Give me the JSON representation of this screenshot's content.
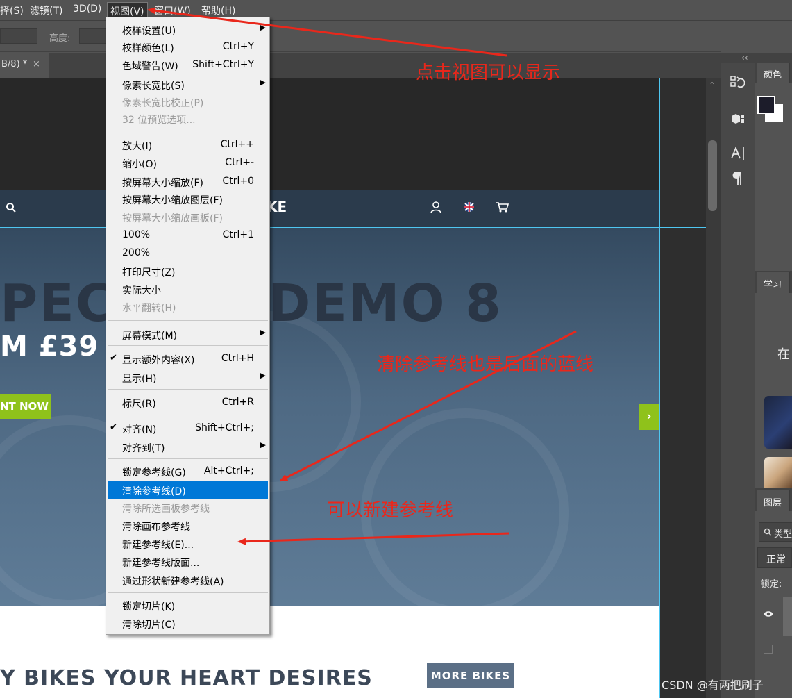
{
  "menubar": {
    "items": [
      "择(S)",
      "滤镜(T)",
      "3D(D)",
      "视图(V)",
      "窗口(W)",
      "帮助(H)"
    ],
    "active_index": 3
  },
  "options_bar": {
    "height_label": "高度:"
  },
  "document_tab": {
    "label": "B/8) *",
    "close": "×"
  },
  "canvas": {
    "header_logo_fragment": "KE",
    "hero_title_left": "PECIA",
    "hero_title_right": "DEMO 8",
    "hero_from": "M £39",
    "hero_button": "NT NOW",
    "hero_next": "›",
    "bottom_heading": "Y BIKES YOUR HEART DESIRES",
    "more_bikes_button": "MORE BIKES"
  },
  "scrollbar": {
    "up_arrow": "⌃"
  },
  "dock": {
    "collapse": "‹‹",
    "tools": [
      "history-icon",
      "3d-icon",
      "character-icon",
      "paragraph-icon"
    ],
    "panels": {
      "color": {
        "tab": "颜色"
      },
      "learn": {
        "tab": "学习",
        "text": "在"
      },
      "layers": {
        "tab": "图层",
        "search": "类型",
        "blend_mode": "正常",
        "lock_label": "锁定:"
      }
    }
  },
  "view_menu": {
    "items": [
      {
        "label": "校样设置(U)",
        "shortcut": "",
        "submenu": true
      },
      {
        "label": "校样颜色(L)",
        "shortcut": "Ctrl+Y"
      },
      {
        "label": "色域警告(W)",
        "shortcut": "Shift+Ctrl+Y"
      },
      {
        "label": "像素长宽比(S)",
        "shortcut": "",
        "submenu": true
      },
      {
        "label": "像素长宽比校正(P)",
        "shortcut": "",
        "disabled": true
      },
      {
        "label": "32 位预览选项...",
        "shortcut": "",
        "disabled": true
      },
      {
        "label": "放大(I)",
        "shortcut": "Ctrl++"
      },
      {
        "label": "缩小(O)",
        "shortcut": "Ctrl+-"
      },
      {
        "label": "按屏幕大小缩放(F)",
        "shortcut": "Ctrl+0"
      },
      {
        "label": "按屏幕大小缩放图层(F)",
        "shortcut": ""
      },
      {
        "label": "按屏幕大小缩放画板(F)",
        "shortcut": "",
        "disabled": true
      },
      {
        "label": "100%",
        "shortcut": "Ctrl+1"
      },
      {
        "label": "200%",
        "shortcut": ""
      },
      {
        "label": "打印尺寸(Z)",
        "shortcut": ""
      },
      {
        "label": "实际大小",
        "shortcut": ""
      },
      {
        "label": "水平翻转(H)",
        "shortcut": "",
        "disabled": true
      },
      {
        "label": "屏幕模式(M)",
        "shortcut": "",
        "submenu": true
      },
      {
        "label": "显示额外内容(X)",
        "shortcut": "Ctrl+H",
        "checked": true
      },
      {
        "label": "显示(H)",
        "shortcut": "",
        "submenu": true
      },
      {
        "label": "标尺(R)",
        "shortcut": "Ctrl+R"
      },
      {
        "label": "对齐(N)",
        "shortcut": "Shift+Ctrl+;",
        "checked": true
      },
      {
        "label": "对齐到(T)",
        "shortcut": "",
        "submenu": true
      },
      {
        "label": "锁定参考线(G)",
        "shortcut": "Alt+Ctrl+;"
      },
      {
        "label": "清除参考线(D)",
        "shortcut": "",
        "highlighted": true
      },
      {
        "label": "清除所选画板参考线",
        "shortcut": "",
        "disabled": true
      },
      {
        "label": "清除画布参考线",
        "shortcut": ""
      },
      {
        "label": "新建参考线(E)...",
        "shortcut": ""
      },
      {
        "label": "新建参考线版面...",
        "shortcut": ""
      },
      {
        "label": "通过形状新建参考线(A)",
        "shortcut": ""
      },
      {
        "label": "锁定切片(K)",
        "shortcut": ""
      },
      {
        "label": "清除切片(C)",
        "shortcut": ""
      }
    ],
    "check_mark": "✔",
    "submenu_arrow": "▶"
  },
  "annotations": {
    "view_hint": "点击视图可以显示",
    "clear_hint": "清除参考线也是后面的蓝线",
    "new_hint": "可以新建参考线",
    "arrow_color": "#e9271b"
  },
  "watermark": "CSDN @有两把刷子"
}
